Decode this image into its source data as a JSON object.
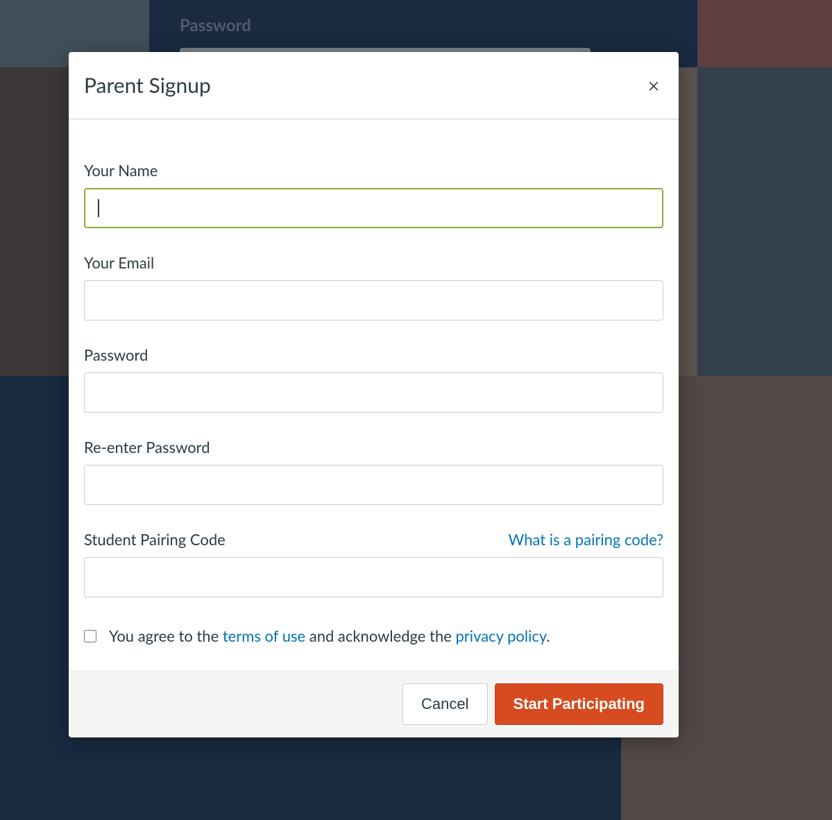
{
  "background": {
    "password_label": "Password"
  },
  "modal": {
    "title": "Parent Signup",
    "fields": {
      "name": {
        "label": "Your Name",
        "value": "",
        "placeholder": ""
      },
      "email": {
        "label": "Your Email",
        "value": "",
        "placeholder": ""
      },
      "password": {
        "label": "Password",
        "value": "",
        "placeholder": ""
      },
      "password_confirm": {
        "label": "Re-enter Password",
        "value": "",
        "placeholder": ""
      },
      "pairing_code": {
        "label": "Student Pairing Code",
        "help_text": "What is a pairing code?",
        "value": "",
        "placeholder": ""
      }
    },
    "terms": {
      "checked": false,
      "prefix": "You agree to the ",
      "terms_link": "terms of use",
      "middle": " and acknowledge the ",
      "privacy_link": "privacy policy",
      "suffix": "."
    },
    "buttons": {
      "cancel": "Cancel",
      "submit": "Start Participating"
    }
  },
  "colors": {
    "accent": "#d64b1f",
    "link": "#0374b5",
    "focus_border": "#8aad3a"
  }
}
